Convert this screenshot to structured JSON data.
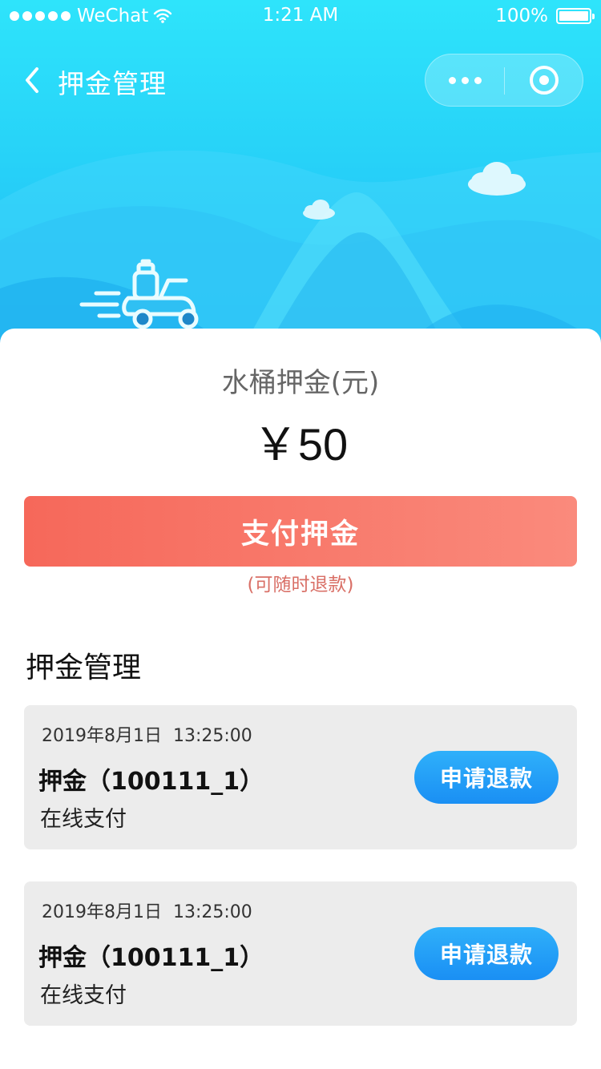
{
  "status_bar": {
    "carrier": "WeChat",
    "time": "1:21 AM",
    "battery": "100%"
  },
  "navbar": {
    "title": "押金管理",
    "icons": [
      "chevron-left-icon",
      "more-icon",
      "target-icon"
    ]
  },
  "colors": {
    "header_gradient_top": "#2ee4fb",
    "header_gradient_bottom": "#1fb7f3",
    "pay_button_start": "#f6685a",
    "pay_button_end": "#fa8a7c",
    "refund_button": "#1a8ff4",
    "card_bg": "#ececec"
  },
  "deposit": {
    "label": "水桶押金(元)",
    "amount": "￥50",
    "pay_label": "支付押金",
    "refund_hint": "(可随时退款)"
  },
  "records_section": {
    "title": "押金管理",
    "items": [
      {
        "time": "2019年8月1日  13:25:00",
        "title": "押金（100111_1）",
        "method": "在线支付",
        "refund_label": "申请退款"
      },
      {
        "time": "2019年8月1日  13:25:00",
        "title": "押金（100111_1）",
        "method": "在线支付",
        "refund_label": "申请退款"
      }
    ]
  }
}
